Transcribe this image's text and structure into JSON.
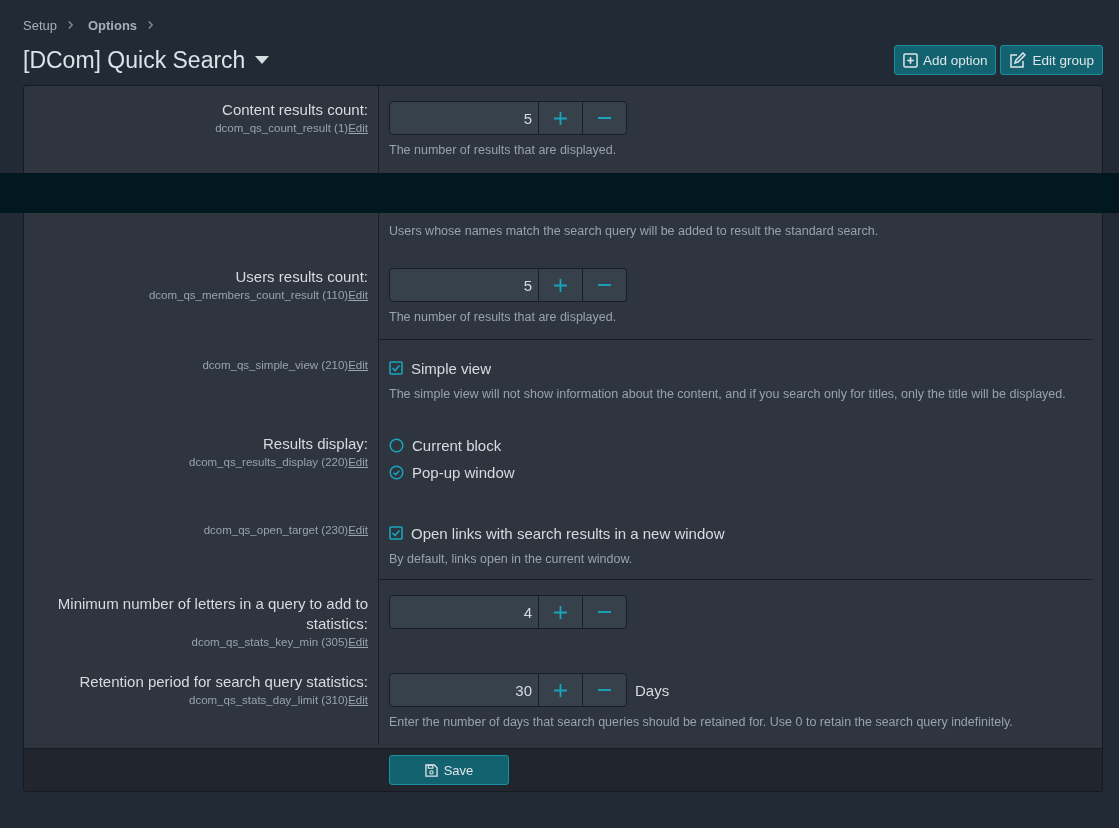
{
  "breadcrumb": [
    {
      "label": "Setup",
      "current": false
    },
    {
      "label": "Options",
      "current": true
    }
  ],
  "title": "[DCom] Quick Search",
  "header_buttons": [
    {
      "label": "Add option",
      "kind": "add"
    },
    {
      "label": "Edit group",
      "kind": "edit"
    }
  ],
  "options": [
    {
      "kind": "number",
      "label": "Content results count:",
      "key_text": "dcom_qs_count_result (1)",
      "edit": "Edit",
      "value": "5",
      "description": "The number of results that are displayed.",
      "divider_below": false
    },
    {
      "kind": "note",
      "description": "Users whose names match the search query will be added to result the standard search.",
      "divider_below": false
    },
    {
      "kind": "number",
      "label": "Users results count:",
      "key_text": "dcom_qs_members_count_result (110)",
      "edit": "Edit",
      "value": "5",
      "description": "The number of results that are displayed.",
      "divider_below": true
    },
    {
      "kind": "checkbox",
      "key_text": "dcom_qs_simple_view (210)",
      "edit": "Edit",
      "option_label": "Simple view",
      "checked": true,
      "description": "The simple view will not show information about the content, and if you search only for titles, only the title will be displayed.",
      "divider_below": false
    },
    {
      "kind": "radio",
      "label": "Results display:",
      "key_text": "dcom_qs_results_display (220)",
      "edit": "Edit",
      "choices": [
        {
          "label": "Current block",
          "selected": false
        },
        {
          "label": "Pop-up window",
          "selected": true
        }
      ],
      "divider_below": false
    },
    {
      "kind": "checkbox",
      "key_text": "dcom_qs_open_target (230)",
      "edit": "Edit",
      "option_label": "Open links with search results in a new window",
      "checked": true,
      "description": "By default, links open in the current window.",
      "divider_below": true
    },
    {
      "kind": "number",
      "label": "Minimum number of letters in a query to add to statistics:",
      "key_text": "dcom_qs_stats_key_min (305)",
      "edit": "Edit",
      "value": "4",
      "divider_below": false
    },
    {
      "kind": "number",
      "label": "Retention period for search query statistics:",
      "key_text": "dcom_qs_stats_day_limit (310)",
      "edit": "Edit",
      "value": "30",
      "units": "Days",
      "description": "Enter the number of days that search queries should be retained for. Use 0 to retain the search query indefinitely.",
      "divider_below": false
    }
  ],
  "save_button": "Save"
}
